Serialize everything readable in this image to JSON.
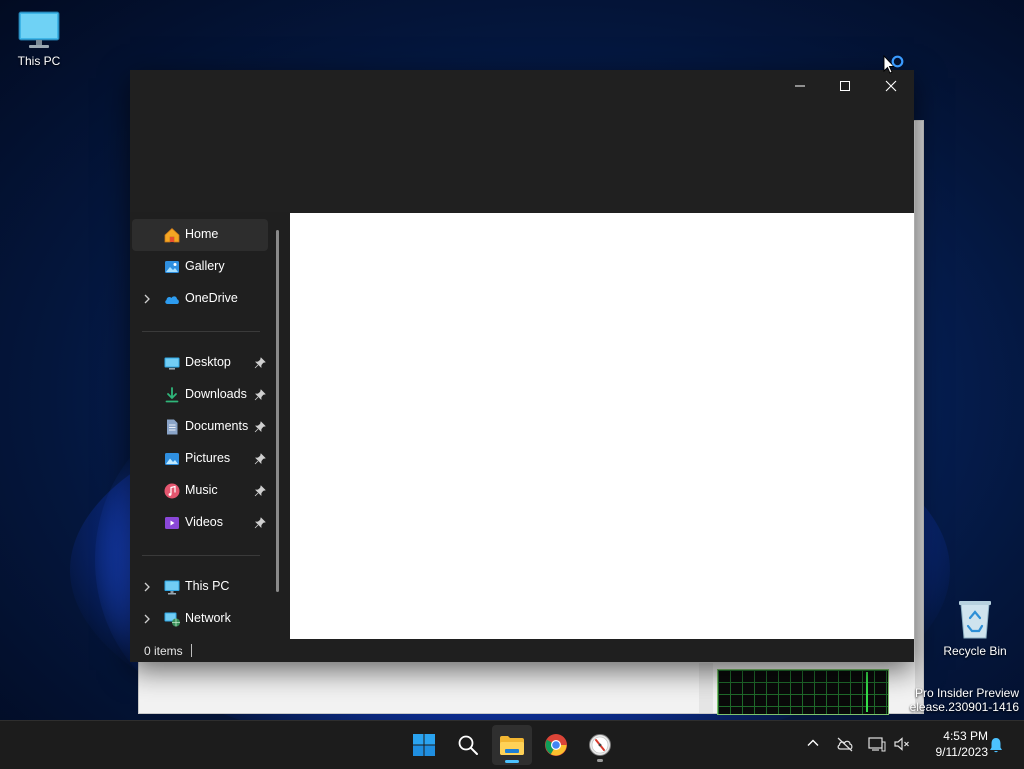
{
  "desktop": {
    "icons": [
      {
        "label": "This PC",
        "icon": "monitor-icon"
      },
      {
        "label": "Recycle Bin",
        "icon": "recycle-bin-icon"
      }
    ],
    "watermark": {
      "line1": "Pro Insider Preview",
      "line2": "elease.230901-1416"
    }
  },
  "explorer": {
    "caption_buttons": [
      "minimize-icon",
      "maximize-icon",
      "close-icon"
    ],
    "nav": {
      "quick": [
        {
          "label": "Home",
          "icon": "home-icon",
          "selected": true,
          "expandable": false
        },
        {
          "label": "Gallery",
          "icon": "gallery-icon",
          "selected": false,
          "expandable": false
        },
        {
          "label": "OneDrive",
          "icon": "cloud-icon",
          "selected": false,
          "expandable": true
        }
      ],
      "pinned": [
        {
          "label": "Desktop",
          "icon": "desktop-folder-icon"
        },
        {
          "label": "Downloads",
          "icon": "download-icon"
        },
        {
          "label": "Documents",
          "icon": "document-icon"
        },
        {
          "label": "Pictures",
          "icon": "pictures-icon"
        },
        {
          "label": "Music",
          "icon": "music-icon"
        },
        {
          "label": "Videos",
          "icon": "video-icon"
        }
      ],
      "locations": [
        {
          "label": "This PC",
          "icon": "monitor-icon"
        },
        {
          "label": "Network",
          "icon": "network-icon"
        }
      ]
    },
    "status": {
      "items_text": "0 items"
    }
  },
  "taskbar": {
    "apps": [
      "start-icon",
      "search-icon",
      "file-explorer-icon",
      "chrome-icon",
      "compass-app-icon"
    ],
    "tray": [
      "chevron-up-icon",
      "onedrive-offline-icon",
      "network-status-icon",
      "volume-muted-icon",
      "notification-bell-icon"
    ],
    "time": "4:53 PM",
    "date": "9/11/2023"
  },
  "colors": {
    "accent": "#4cc2ff",
    "window_bg": "#1f1f1f",
    "content_bg": "#ffffff"
  }
}
